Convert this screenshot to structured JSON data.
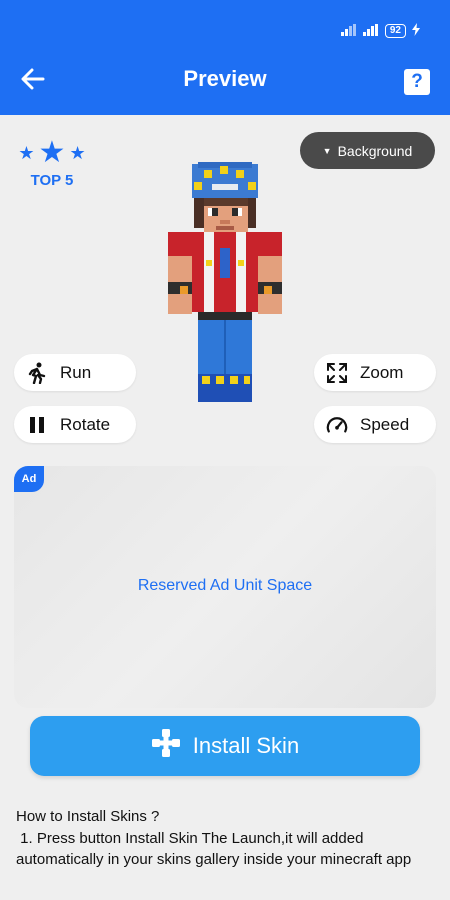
{
  "status_bar": {
    "battery": "92"
  },
  "app_bar": {
    "title": "Preview",
    "help_label": "?"
  },
  "rating": {
    "label": "TOP 5"
  },
  "background_button": {
    "label": "Background"
  },
  "actions": {
    "run": "Run",
    "zoom": "Zoom",
    "rotate": "Rotate",
    "speed": "Speed"
  },
  "ad": {
    "badge": "Ad",
    "text": "Reserved Ad Unit Space"
  },
  "install_button": {
    "label": "Install Skin"
  },
  "instructions": {
    "title": "How to Install Skins ?",
    "step1": " 1. Press button Install Skin The Launch,it will added automatically in your skins gallery inside your minecraft app"
  },
  "colors": {
    "primary": "#1e6ff3",
    "install": "#2d9ef0",
    "background_button": "#4a4a4a",
    "page_bg": "#efefef"
  }
}
